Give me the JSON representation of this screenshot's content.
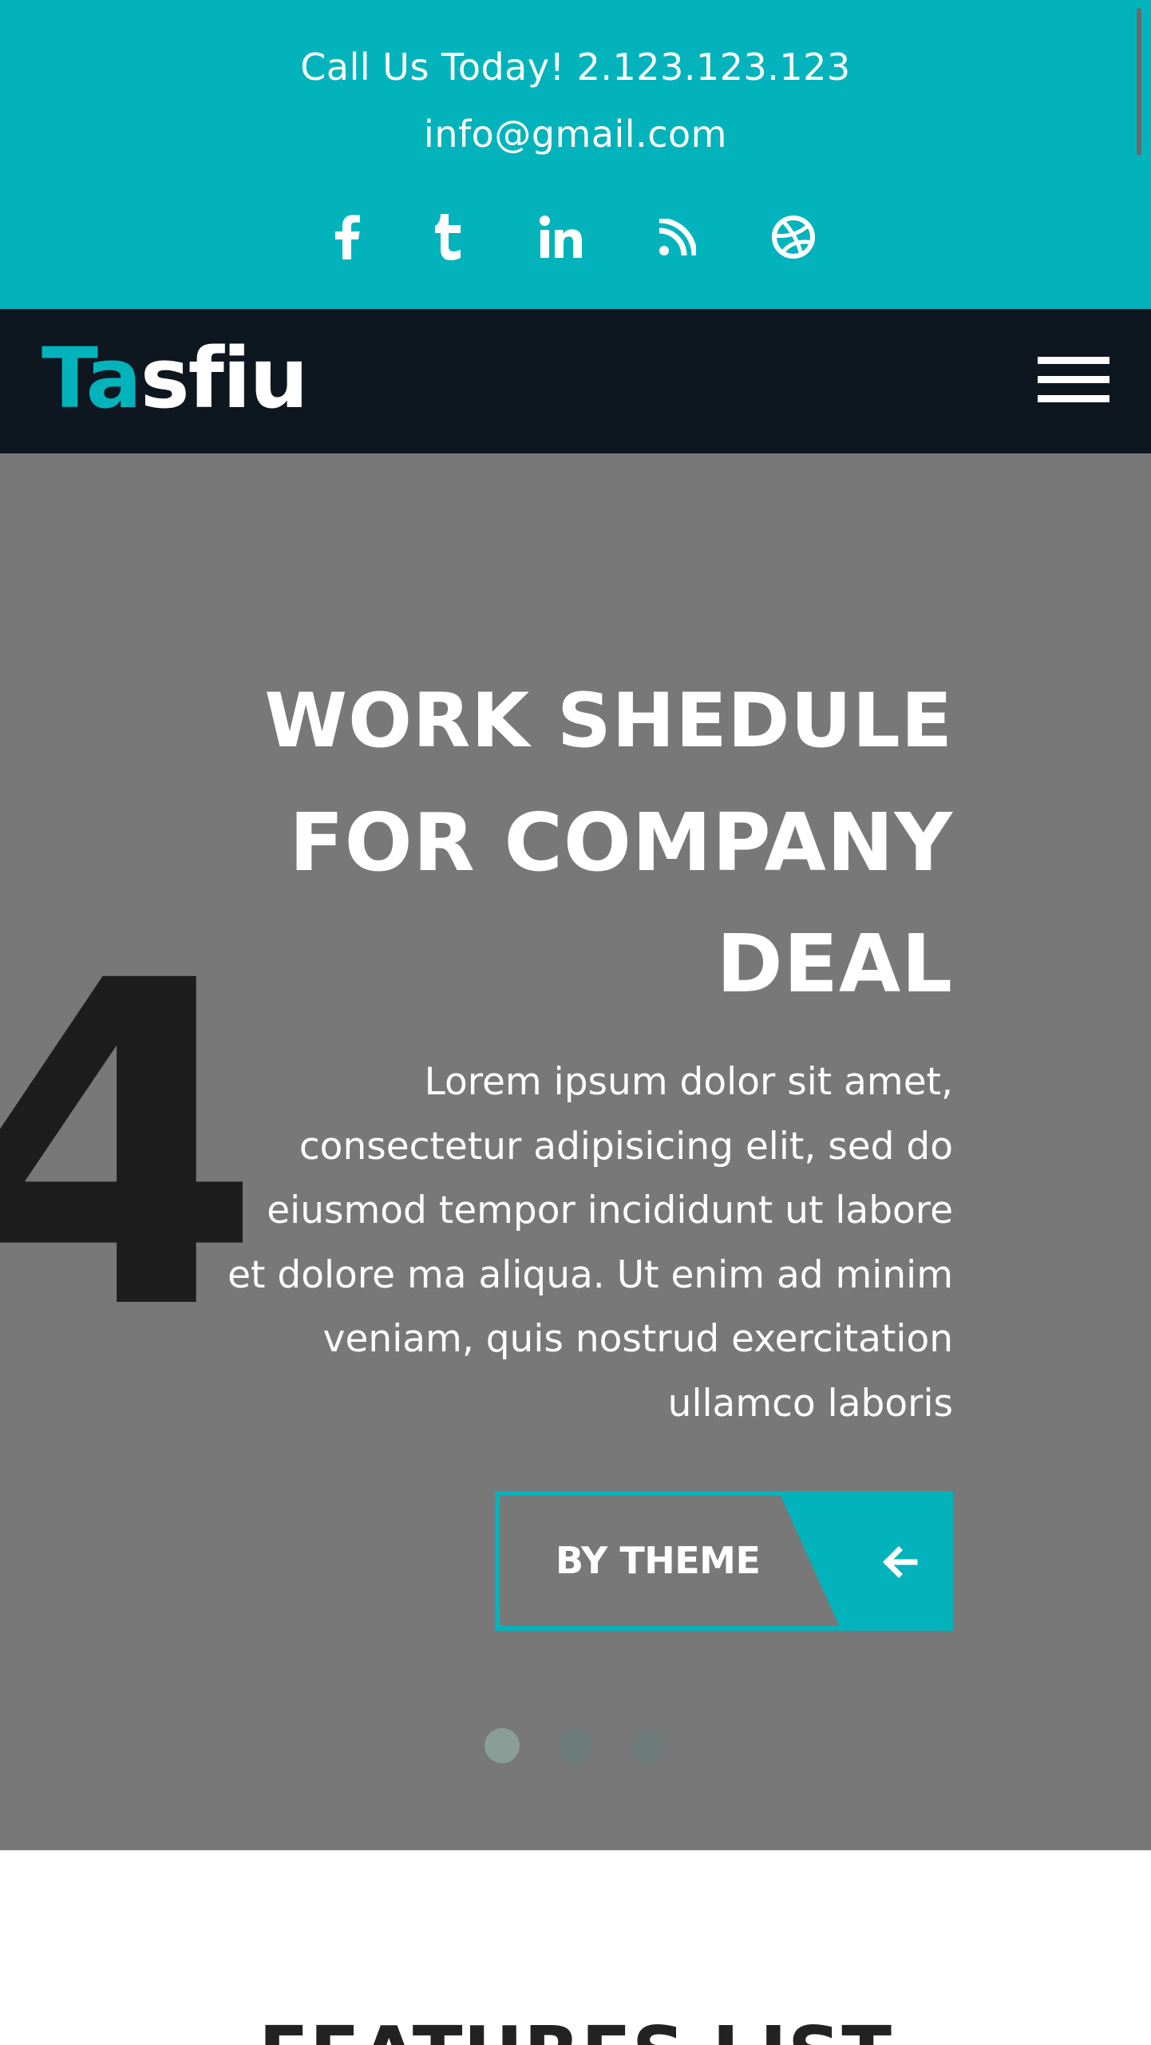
{
  "topbar": {
    "phone": "Call Us Today! 2.123.123.123",
    "email": "info@gmail.com",
    "social": [
      {
        "icon": "facebook-icon"
      },
      {
        "icon": "tumblr-icon"
      },
      {
        "icon": "linkedin-icon"
      },
      {
        "icon": "rss-icon"
      },
      {
        "icon": "dribbble-icon"
      }
    ]
  },
  "navbar": {
    "logo_part1": "Ta",
    "logo_part2": "sfiu",
    "menu_icon": "hamburger-menu-icon"
  },
  "hero": {
    "title_line1": "WORK SHEDULE",
    "title_line2": "FOR COMPANY",
    "title_line3": "DEAL",
    "text_lines": [
      "Lorem ipsum dolor sit amet,",
      "consectetur adipisicing elit, sed do",
      "eiusmod tempor incididunt ut labore",
      "et dolore ma aliqua. Ut enim ad minim",
      "veniam, quis nostrud exercitation",
      "ullamco laboris"
    ],
    "background_digit": "4",
    "cta_label": "BY THEME",
    "cta_icon": "arrow-left-icon",
    "slides_total": 3,
    "active_slide": 1
  },
  "features": {
    "title": "FEATURES LIST"
  },
  "colors": {
    "accent": "#02b3bc",
    "nav_bg": "#0e1720",
    "hero_bg": "#787878"
  }
}
